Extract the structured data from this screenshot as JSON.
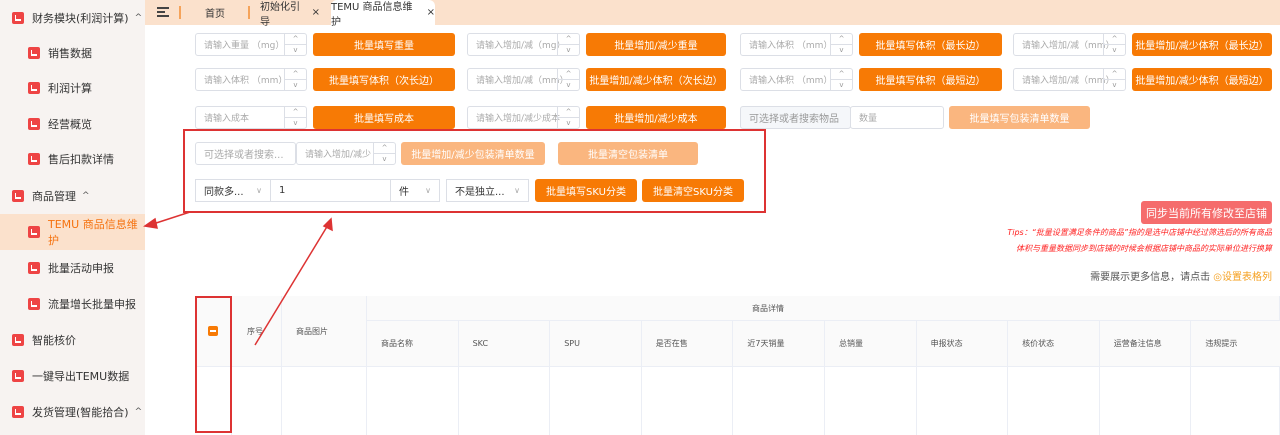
{
  "sidebar": {
    "items": [
      {
        "label": "财务模块(利润计算)",
        "level": "top",
        "expanded": true
      },
      {
        "label": "销售数据",
        "level": "sub"
      },
      {
        "label": "利润计算",
        "level": "sub"
      },
      {
        "label": "经营概览",
        "level": "sub"
      },
      {
        "label": "售后扣款详情",
        "level": "sub"
      },
      {
        "label": "商品管理",
        "level": "top",
        "expanded": true
      },
      {
        "label": "TEMU 商品信息维护",
        "level": "sub",
        "active": true
      },
      {
        "label": "批量活动申报",
        "level": "sub"
      },
      {
        "label": "流量增长批量申报",
        "level": "sub"
      },
      {
        "label": "智能核价",
        "level": "top"
      },
      {
        "label": "一键导出TEMU数据",
        "level": "top"
      },
      {
        "label": "发货管理(智能拾合)",
        "level": "top",
        "expanded": true
      }
    ]
  },
  "tabs": [
    {
      "label": "首页"
    },
    {
      "label": "初始化引导",
      "closable": true
    },
    {
      "label": "TEMU 商品信息维护",
      "closable": true,
      "active": true
    }
  ],
  "form": {
    "row1": [
      {
        "placeholder": "请输入重量 （mg）",
        "button": "批量填写重量"
      },
      {
        "placeholder": "请输入增加/减（mg）",
        "button": "批量增加/减少重量"
      },
      {
        "placeholder": "请输入体积 （mm）",
        "button": "批量填写体积（最长边）"
      },
      {
        "placeholder": "请输入增加/减（mm）",
        "button": "批量增加/减少体积（最长边）"
      }
    ],
    "row2": [
      {
        "placeholder": "请输入体积 （mm）",
        "button": "批量填写体积（次长边）"
      },
      {
        "placeholder": "请输入增加/减（mm）",
        "button": "批量增加/减少体积（次长边）"
      },
      {
        "placeholder": "请输入体积 （mm）",
        "button": "批量填写体积（最短边）"
      },
      {
        "placeholder": "请输入增加/减（mm）",
        "button": "批量增加/减少体积（最短边）"
      }
    ],
    "row3": [
      {
        "placeholder": "请输入成本",
        "button": "批量填写成本"
      },
      {
        "placeholder": "请输入增加/减少成本",
        "button": "批量增加/减少成本"
      }
    ],
    "package_select_placeholder": "可选择或者搜索物品",
    "package_qty_placeholder": "数量",
    "package_fill_button": "批量填写包装清单数量",
    "pkg_search_placeholder": "可选择或者搜索...",
    "pkg_adjust_placeholder": "请输入增加/减少",
    "pkg_adjust_button": "批量增加/减少包装清单数量",
    "pkg_clear_button": "批量清空包装清单",
    "sku_type_select": "同款多...",
    "sku_qty_value": "1",
    "sku_unit_select": "件",
    "sku_independent_select": "不是独立...",
    "sku_fill_button": "批量填写SKU分类",
    "sku_clear_button": "批量清空SKU分类"
  },
  "sync_button": "同步当前所有修改至店铺",
  "tips": [
    "Tips：“批量设置满足条件的商品”指的是选中店铺中经过筛选后的所有商品",
    "体积与重量数据同步到店铺的时候会根据店铺中商品的实际单位进行换算"
  ],
  "more_info": {
    "text": "需要展示更多信息，请点击",
    "link": "◎设置表格列"
  },
  "table": {
    "group_header": "商品详情",
    "fixed_headers": [
      "序号",
      "商品图片"
    ],
    "columns": [
      "商品名称",
      "SKC",
      "SPU",
      "是否在售",
      "近7天销量",
      "总销量",
      "申报状态",
      "核价状态",
      "运营备注信息",
      "违规提示"
    ],
    "select_all_state": "indeterminate"
  },
  "colors": {
    "accent": "#f77a05",
    "accent_light": "#fab67f",
    "sync": "#f56c6c",
    "annotation": "#d33333"
  }
}
